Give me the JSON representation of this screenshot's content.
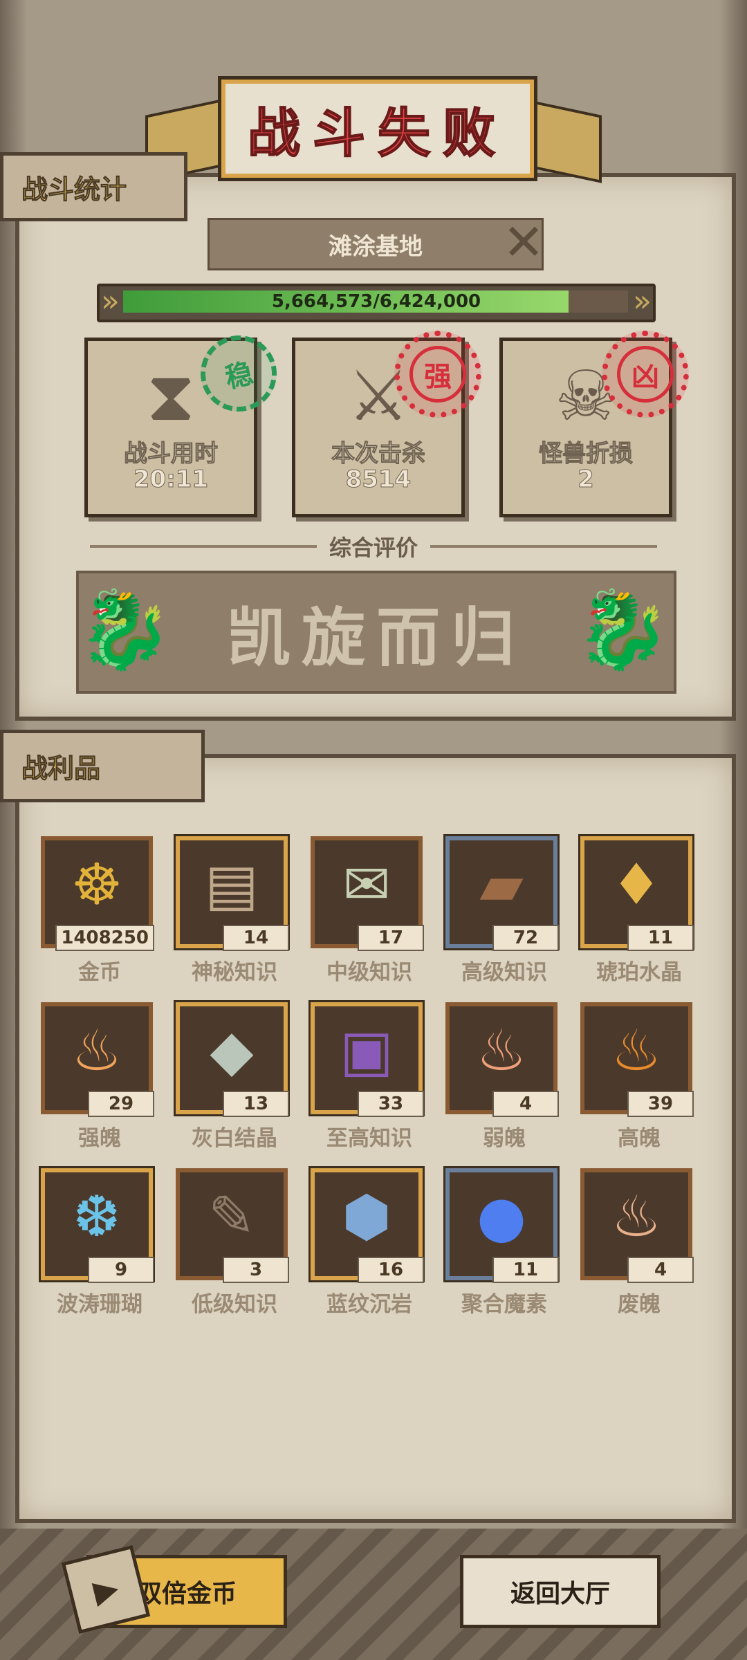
{
  "title": "战斗失败",
  "stats_tab": "战斗统计",
  "location": "滩涂基地",
  "progress": {
    "text": "5,664,573/6,424,000",
    "fraction": 0.8818
  },
  "stats": [
    {
      "label": "战斗用时",
      "value": "20:11",
      "stamp": "稳"
    },
    {
      "label": "本次击杀",
      "value": "8514",
      "stamp": "强"
    },
    {
      "label": "怪兽折损",
      "value": "2",
      "stamp": "凶"
    }
  ],
  "rating": {
    "title": "综合评价",
    "text": "凯旋而归"
  },
  "loot_tab": "战利品",
  "loot": [
    {
      "name": "金币",
      "count": "1408250",
      "icon": "☸",
      "frame": "plain",
      "color": "#e3b339"
    },
    {
      "name": "神秘知识",
      "count": "14",
      "icon": "▤",
      "frame": "gold",
      "color": "#bfa78a"
    },
    {
      "name": "中级知识",
      "count": "17",
      "icon": "✉",
      "frame": "plain",
      "color": "#c7d0b2"
    },
    {
      "name": "高级知识",
      "count": "72",
      "icon": "▰",
      "frame": "blue",
      "color": "#9c6a45"
    },
    {
      "name": "琥珀水晶",
      "count": "11",
      "icon": "♦",
      "frame": "gold",
      "color": "#e7b649"
    },
    {
      "name": "强魄",
      "count": "29",
      "icon": "♨",
      "frame": "plain",
      "color": "#f0a35a"
    },
    {
      "name": "灰白结晶",
      "count": "13",
      "icon": "◆",
      "frame": "gold",
      "color": "#b9c6b9"
    },
    {
      "name": "至高知识",
      "count": "33",
      "icon": "▣",
      "frame": "gold",
      "color": "#8a5ab8"
    },
    {
      "name": "弱魄",
      "count": "4",
      "icon": "♨",
      "frame": "plain",
      "color": "#eea07a"
    },
    {
      "name": "高魄",
      "count": "39",
      "icon": "♨",
      "frame": "plain",
      "color": "#e98a2b"
    },
    {
      "name": "波涛珊瑚",
      "count": "9",
      "icon": "❆",
      "frame": "gold",
      "color": "#6cc3e8"
    },
    {
      "name": "低级知识",
      "count": "3",
      "icon": "✎",
      "frame": "plain",
      "color": "#8e7a66"
    },
    {
      "name": "蓝纹沉岩",
      "count": "16",
      "icon": "⬢",
      "frame": "gold",
      "color": "#7fa8d6"
    },
    {
      "name": "聚合魔素",
      "count": "11",
      "icon": "●",
      "frame": "blue",
      "color": "#4e7ef0"
    },
    {
      "name": "废魄",
      "count": "4",
      "icon": "♨",
      "frame": "plain",
      "color": "#e8b08a"
    }
  ],
  "buttons": {
    "double": "双倍金币",
    "back": "返回大厅"
  }
}
